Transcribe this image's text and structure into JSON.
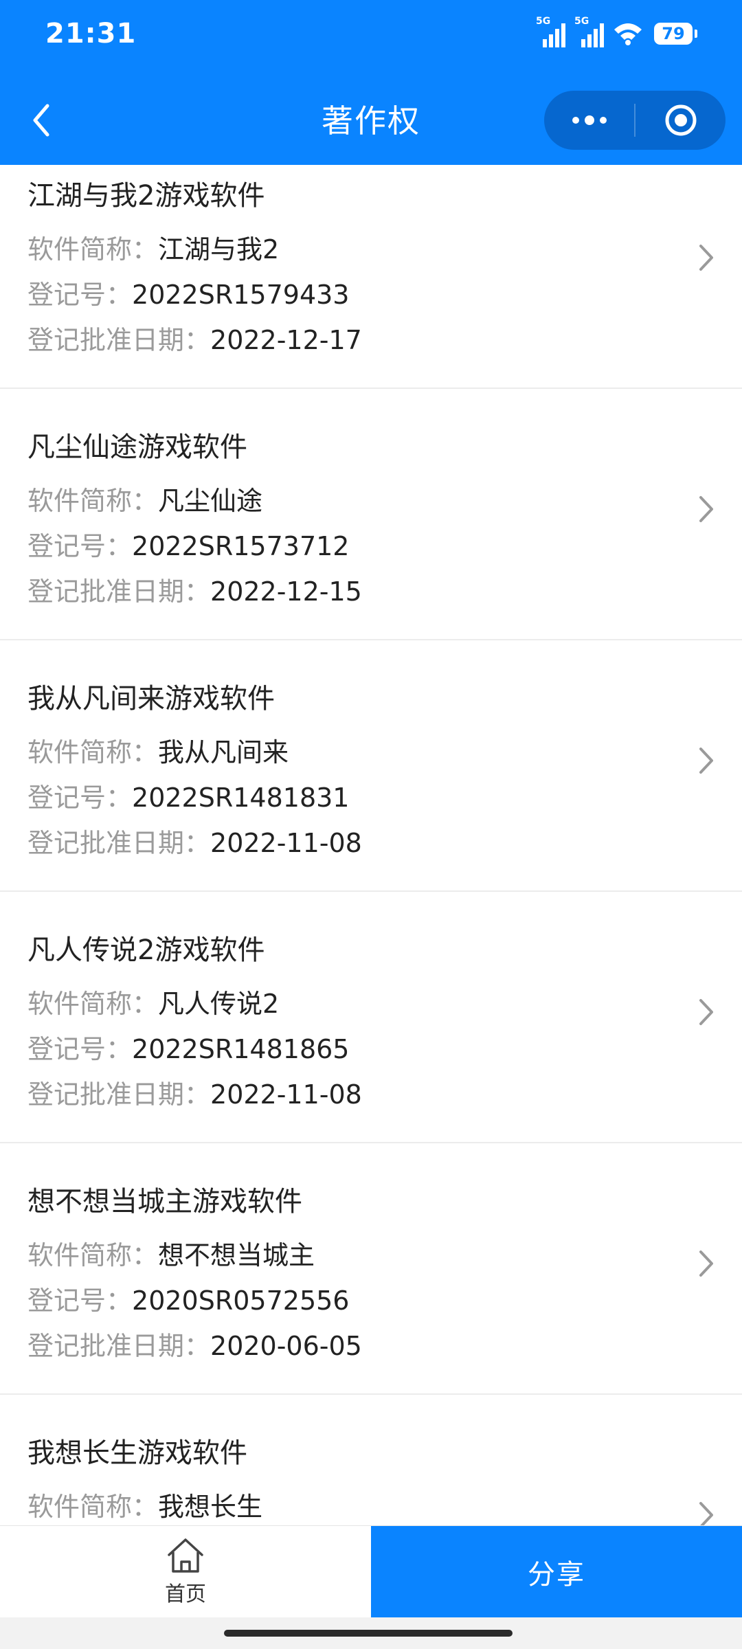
{
  "status_bar": {
    "time": "21:31",
    "network1": "5G",
    "network2": "5G",
    "battery": "79"
  },
  "nav": {
    "title": "著作权"
  },
  "colors": {
    "primary": "#0a84ff",
    "capsule": "#0667cf",
    "label_gray": "#9a9a9a"
  },
  "labels": {
    "short_name": "软件简称：",
    "reg_no": "登记号：",
    "approval_date": "登记批准日期："
  },
  "items": [
    {
      "title": "江湖与我2游戏软件",
      "short_name": "江湖与我2",
      "reg_no": "2022SR1579433",
      "approval_date": "2022-12-17"
    },
    {
      "title": "凡尘仙途游戏软件",
      "short_name": "凡尘仙途",
      "reg_no": "2022SR1573712",
      "approval_date": "2022-12-15"
    },
    {
      "title": "我从凡间来游戏软件",
      "short_name": "我从凡间来",
      "reg_no": "2022SR1481831",
      "approval_date": "2022-11-08"
    },
    {
      "title": "凡人传说2游戏软件",
      "short_name": "凡人传说2",
      "reg_no": "2022SR1481865",
      "approval_date": "2022-11-08"
    },
    {
      "title": "想不想当城主游戏软件",
      "short_name": "想不想当城主",
      "reg_no": "2020SR0572556",
      "approval_date": "2020-06-05"
    },
    {
      "title": "我想长生游戏软件",
      "short_name": "我想长生",
      "reg_no": "",
      "approval_date": ""
    }
  ],
  "bottom": {
    "home_label": "首页",
    "share_label": "分享"
  },
  "icons": {
    "back": "chevron-left-icon",
    "more": "more-dots-icon",
    "close": "target-circle-icon",
    "row_arrow": "chevron-right-icon",
    "home": "home-icon"
  }
}
